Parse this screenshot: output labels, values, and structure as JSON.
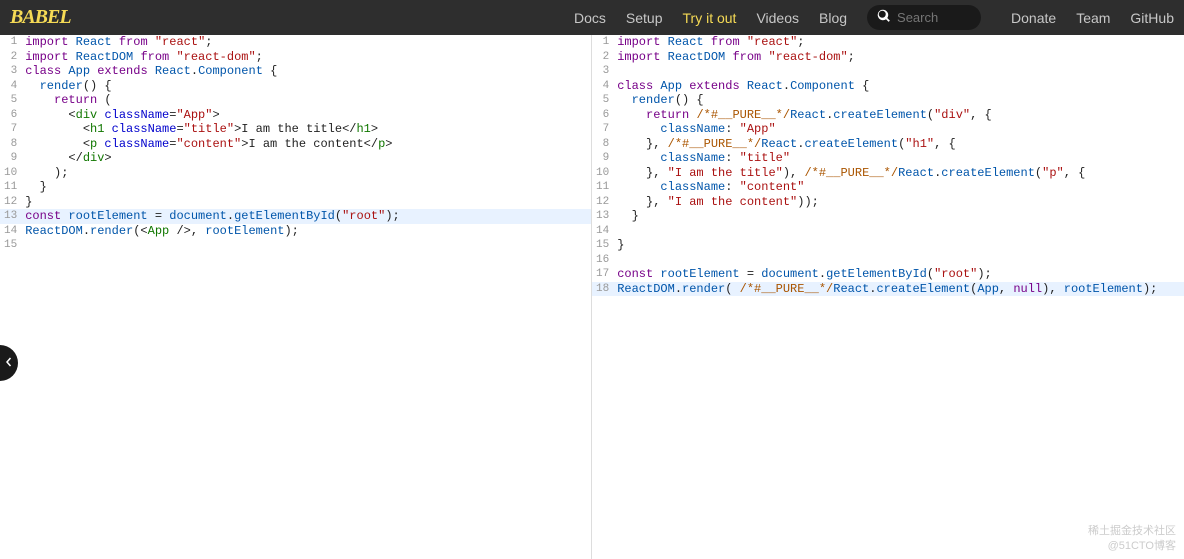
{
  "header": {
    "logo": "BABEL",
    "nav": [
      {
        "label": "Docs",
        "active": false
      },
      {
        "label": "Setup",
        "active": false
      },
      {
        "label": "Try it out",
        "active": true
      },
      {
        "label": "Videos",
        "active": false
      },
      {
        "label": "Blog",
        "active": false
      }
    ],
    "search_placeholder": "Search",
    "nav2": [
      {
        "label": "Donate"
      },
      {
        "label": "Team"
      },
      {
        "label": "GitHub"
      }
    ]
  },
  "left_highlight_line": 13,
  "right_highlight_line": 18,
  "left_code": [
    [
      {
        "t": "import",
        "c": "kw"
      },
      {
        "t": " ",
        "c": "pl"
      },
      {
        "t": "React",
        "c": "var"
      },
      {
        "t": " ",
        "c": "pl"
      },
      {
        "t": "from",
        "c": "kw"
      },
      {
        "t": " ",
        "c": "pl"
      },
      {
        "t": "\"react\"",
        "c": "str"
      },
      {
        "t": ";",
        "c": "pl"
      }
    ],
    [
      {
        "t": "import",
        "c": "kw"
      },
      {
        "t": " ",
        "c": "pl"
      },
      {
        "t": "ReactDOM",
        "c": "var"
      },
      {
        "t": " ",
        "c": "pl"
      },
      {
        "t": "from",
        "c": "kw"
      },
      {
        "t": " ",
        "c": "pl"
      },
      {
        "t": "\"react-dom\"",
        "c": "str"
      },
      {
        "t": ";",
        "c": "pl"
      }
    ],
    [
      {
        "t": "class",
        "c": "kw"
      },
      {
        "t": " ",
        "c": "pl"
      },
      {
        "t": "App",
        "c": "var"
      },
      {
        "t": " ",
        "c": "pl"
      },
      {
        "t": "extends",
        "c": "kw"
      },
      {
        "t": " ",
        "c": "pl"
      },
      {
        "t": "React",
        "c": "var"
      },
      {
        "t": ".",
        "c": "pl"
      },
      {
        "t": "Component",
        "c": "var"
      },
      {
        "t": " {",
        "c": "pl"
      }
    ],
    [
      {
        "t": "  ",
        "c": "pl"
      },
      {
        "t": "render",
        "c": "var"
      },
      {
        "t": "() {",
        "c": "pl"
      }
    ],
    [
      {
        "t": "    ",
        "c": "pl"
      },
      {
        "t": "return",
        "c": "kw"
      },
      {
        "t": " (",
        "c": "pl"
      }
    ],
    [
      {
        "t": "      <",
        "c": "pl"
      },
      {
        "t": "div",
        "c": "tag"
      },
      {
        "t": " ",
        "c": "pl"
      },
      {
        "t": "className",
        "c": "attr"
      },
      {
        "t": "=",
        "c": "pl"
      },
      {
        "t": "\"App\"",
        "c": "str"
      },
      {
        "t": ">",
        "c": "pl"
      }
    ],
    [
      {
        "t": "        <",
        "c": "pl"
      },
      {
        "t": "h1",
        "c": "tag"
      },
      {
        "t": " ",
        "c": "pl"
      },
      {
        "t": "className",
        "c": "attr"
      },
      {
        "t": "=",
        "c": "pl"
      },
      {
        "t": "\"title\"",
        "c": "str"
      },
      {
        "t": ">I am the title</",
        "c": "pl"
      },
      {
        "t": "h1",
        "c": "tag"
      },
      {
        "t": ">",
        "c": "pl"
      }
    ],
    [
      {
        "t": "        <",
        "c": "pl"
      },
      {
        "t": "p",
        "c": "tag"
      },
      {
        "t": " ",
        "c": "pl"
      },
      {
        "t": "className",
        "c": "attr"
      },
      {
        "t": "=",
        "c": "pl"
      },
      {
        "t": "\"content\"",
        "c": "str"
      },
      {
        "t": ">I am the content</",
        "c": "pl"
      },
      {
        "t": "p",
        "c": "tag"
      },
      {
        "t": ">",
        "c": "pl"
      }
    ],
    [
      {
        "t": "      </",
        "c": "pl"
      },
      {
        "t": "div",
        "c": "tag"
      },
      {
        "t": ">",
        "c": "pl"
      }
    ],
    [
      {
        "t": "    );",
        "c": "pl"
      }
    ],
    [
      {
        "t": "  }",
        "c": "pl"
      }
    ],
    [
      {
        "t": "}",
        "c": "pl"
      }
    ],
    [
      {
        "t": "const",
        "c": "kw"
      },
      {
        "t": " ",
        "c": "pl"
      },
      {
        "t": "rootElement",
        "c": "var"
      },
      {
        "t": " = ",
        "c": "pl"
      },
      {
        "t": "document",
        "c": "var"
      },
      {
        "t": ".",
        "c": "pl"
      },
      {
        "t": "getElementById",
        "c": "var"
      },
      {
        "t": "(",
        "c": "pl"
      },
      {
        "t": "\"root\"",
        "c": "str"
      },
      {
        "t": ");",
        "c": "pl"
      }
    ],
    [
      {
        "t": "ReactDOM",
        "c": "var"
      },
      {
        "t": ".",
        "c": "pl"
      },
      {
        "t": "render",
        "c": "var"
      },
      {
        "t": "(<",
        "c": "pl"
      },
      {
        "t": "App",
        "c": "tag"
      },
      {
        "t": " />, ",
        "c": "pl"
      },
      {
        "t": "rootElement",
        "c": "var"
      },
      {
        "t": ");",
        "c": "pl"
      }
    ],
    []
  ],
  "right_code": [
    [
      {
        "t": "import",
        "c": "kw"
      },
      {
        "t": " ",
        "c": "pl"
      },
      {
        "t": "React",
        "c": "var"
      },
      {
        "t": " ",
        "c": "pl"
      },
      {
        "t": "from",
        "c": "kw"
      },
      {
        "t": " ",
        "c": "pl"
      },
      {
        "t": "\"react\"",
        "c": "str"
      },
      {
        "t": ";",
        "c": "pl"
      }
    ],
    [
      {
        "t": "import",
        "c": "kw"
      },
      {
        "t": " ",
        "c": "pl"
      },
      {
        "t": "ReactDOM",
        "c": "var"
      },
      {
        "t": " ",
        "c": "pl"
      },
      {
        "t": "from",
        "c": "kw"
      },
      {
        "t": " ",
        "c": "pl"
      },
      {
        "t": "\"react-dom\"",
        "c": "str"
      },
      {
        "t": ";",
        "c": "pl"
      }
    ],
    [],
    [
      {
        "t": "class",
        "c": "kw"
      },
      {
        "t": " ",
        "c": "pl"
      },
      {
        "t": "App",
        "c": "var"
      },
      {
        "t": " ",
        "c": "pl"
      },
      {
        "t": "extends",
        "c": "kw"
      },
      {
        "t": " ",
        "c": "pl"
      },
      {
        "t": "React",
        "c": "var"
      },
      {
        "t": ".",
        "c": "pl"
      },
      {
        "t": "Component",
        "c": "var"
      },
      {
        "t": " {",
        "c": "pl"
      }
    ],
    [
      {
        "t": "  ",
        "c": "pl"
      },
      {
        "t": "render",
        "c": "var"
      },
      {
        "t": "() {",
        "c": "pl"
      }
    ],
    [
      {
        "t": "    ",
        "c": "pl"
      },
      {
        "t": "return",
        "c": "kw"
      },
      {
        "t": " ",
        "c": "pl"
      },
      {
        "t": "/*#__PURE__*/",
        "c": "cmt"
      },
      {
        "t": "React",
        "c": "var"
      },
      {
        "t": ".",
        "c": "pl"
      },
      {
        "t": "createElement",
        "c": "var"
      },
      {
        "t": "(",
        "c": "pl"
      },
      {
        "t": "\"div\"",
        "c": "str"
      },
      {
        "t": ", {",
        "c": "pl"
      }
    ],
    [
      {
        "t": "      ",
        "c": "pl"
      },
      {
        "t": "className",
        "c": "var"
      },
      {
        "t": ": ",
        "c": "pl"
      },
      {
        "t": "\"App\"",
        "c": "str"
      }
    ],
    [
      {
        "t": "    }, ",
        "c": "pl"
      },
      {
        "t": "/*#__PURE__*/",
        "c": "cmt"
      },
      {
        "t": "React",
        "c": "var"
      },
      {
        "t": ".",
        "c": "pl"
      },
      {
        "t": "createElement",
        "c": "var"
      },
      {
        "t": "(",
        "c": "pl"
      },
      {
        "t": "\"h1\"",
        "c": "str"
      },
      {
        "t": ", {",
        "c": "pl"
      }
    ],
    [
      {
        "t": "      ",
        "c": "pl"
      },
      {
        "t": "className",
        "c": "var"
      },
      {
        "t": ": ",
        "c": "pl"
      },
      {
        "t": "\"title\"",
        "c": "str"
      }
    ],
    [
      {
        "t": "    }, ",
        "c": "pl"
      },
      {
        "t": "\"I am the title\"",
        "c": "str"
      },
      {
        "t": "), ",
        "c": "pl"
      },
      {
        "t": "/*#__PURE__*/",
        "c": "cmt"
      },
      {
        "t": "React",
        "c": "var"
      },
      {
        "t": ".",
        "c": "pl"
      },
      {
        "t": "createElement",
        "c": "var"
      },
      {
        "t": "(",
        "c": "pl"
      },
      {
        "t": "\"p\"",
        "c": "str"
      },
      {
        "t": ", {",
        "c": "pl"
      }
    ],
    [
      {
        "t": "      ",
        "c": "pl"
      },
      {
        "t": "className",
        "c": "var"
      },
      {
        "t": ": ",
        "c": "pl"
      },
      {
        "t": "\"content\"",
        "c": "str"
      }
    ],
    [
      {
        "t": "    }, ",
        "c": "pl"
      },
      {
        "t": "\"I am the content\"",
        "c": "str"
      },
      {
        "t": "));",
        "c": "pl"
      }
    ],
    [
      {
        "t": "  }",
        "c": "pl"
      }
    ],
    [],
    [
      {
        "t": "}",
        "c": "pl"
      }
    ],
    [],
    [
      {
        "t": "const",
        "c": "kw"
      },
      {
        "t": " ",
        "c": "pl"
      },
      {
        "t": "rootElement",
        "c": "var"
      },
      {
        "t": " = ",
        "c": "pl"
      },
      {
        "t": "document",
        "c": "var"
      },
      {
        "t": ".",
        "c": "pl"
      },
      {
        "t": "getElementById",
        "c": "var"
      },
      {
        "t": "(",
        "c": "pl"
      },
      {
        "t": "\"root\"",
        "c": "str"
      },
      {
        "t": ");",
        "c": "pl"
      }
    ],
    [
      {
        "t": "ReactDOM",
        "c": "var"
      },
      {
        "t": ".",
        "c": "pl"
      },
      {
        "t": "render",
        "c": "var"
      },
      {
        "t": "( ",
        "c": "pl"
      },
      {
        "t": "/*#__PURE__*/",
        "c": "cmt"
      },
      {
        "t": "React",
        "c": "var"
      },
      {
        "t": ".",
        "c": "pl"
      },
      {
        "t": "createElement",
        "c": "var"
      },
      {
        "t": "(",
        "c": "pl"
      },
      {
        "t": "App",
        "c": "var"
      },
      {
        "t": ", ",
        "c": "pl"
      },
      {
        "t": "null",
        "c": "kw"
      },
      {
        "t": "), ",
        "c": "pl"
      },
      {
        "t": "rootElement",
        "c": "var"
      },
      {
        "t": ");",
        "c": "pl"
      }
    ]
  ],
  "watermark": {
    "line1": "稀土掘金技术社区",
    "line2": "@51CTO博客"
  }
}
